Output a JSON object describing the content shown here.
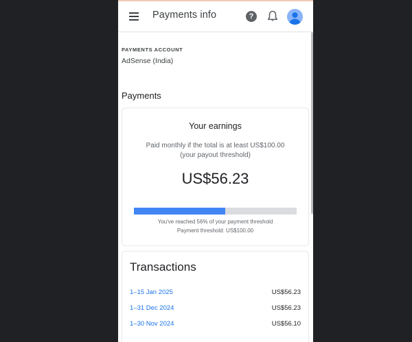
{
  "app": {
    "title": "Payments info",
    "menu_icon": "menu-icon",
    "help_icon": "help-icon",
    "help_glyph": "?",
    "notifications_icon": "bell-icon",
    "avatar_icon": "account-avatar-icon"
  },
  "account": {
    "label": "PAYMENTS ACCOUNT",
    "name": "AdSense (India)"
  },
  "payments": {
    "heading": "Payments"
  },
  "earnings": {
    "title": "Your earnings",
    "description_line1": "Paid monthly if the total is at least US$100.00",
    "description_line2": "(your payout threshold)",
    "amount": "US$56.23",
    "progress_fraction": 0.56,
    "progress_text": "You've reached 56% of your payment threshold",
    "threshold_text": "Payment threshold: US$100.00"
  },
  "transactions": {
    "title": "Transactions",
    "rows": [
      {
        "date": "1–15 Jan 2025",
        "amount": "US$56.23"
      },
      {
        "date": "1–31 Dec 2024",
        "amount": "US$56.23"
      },
      {
        "date": "1–30 Nov 2024",
        "amount": "US$56.10"
      }
    ]
  },
  "colors": {
    "background": "#202124",
    "accent": "#4285f4",
    "link": "#1a73e8",
    "track": "#dadce0"
  }
}
